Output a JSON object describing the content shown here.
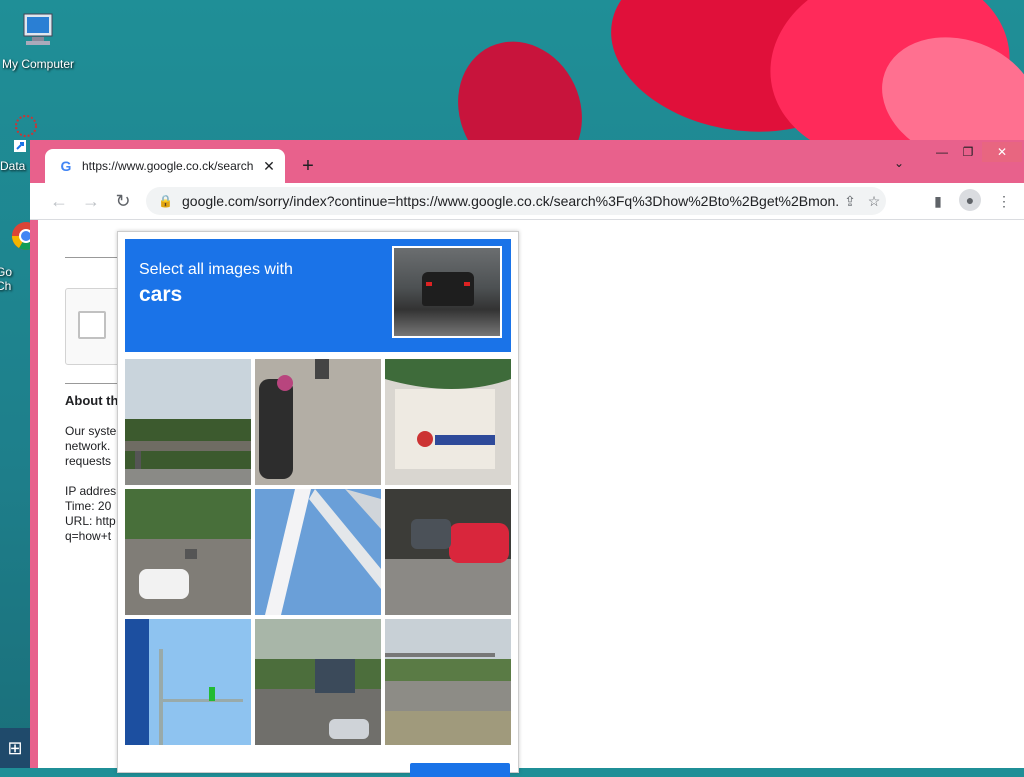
{
  "desktop": {
    "icons": [
      {
        "label": "My Computer"
      },
      {
        "label": "Data"
      },
      {
        "label": "Go Ch"
      }
    ]
  },
  "browser": {
    "tab": {
      "favicon": "G",
      "title": "https://www.google.co.ck/search"
    },
    "url": "google.com/sorry/index?continue=https://www.google.co.ck/search%3Fq%3Dhow%2Bto%2Bget%2Bmon..."
  },
  "page": {
    "about_heading": "About th",
    "paragraph": [
      "Our syste",
      "network.",
      "requests"
    ],
    "details": [
      "IP addres",
      "Time: 20",
      "URL: http",
      "q=how+t"
    ]
  },
  "captcha": {
    "instruction": "Select all images with",
    "target": "cars",
    "tiles": [
      {
        "label": "overpass-bridge"
      },
      {
        "label": "motorcycle"
      },
      {
        "label": "building-street"
      },
      {
        "label": "road-traffic-white-car"
      },
      {
        "label": "steel-truss-bridge"
      },
      {
        "label": "parked-red-car"
      },
      {
        "label": "traffic-light-pole"
      },
      {
        "label": "highway-cars-bus"
      },
      {
        "label": "roadside-bridge"
      }
    ]
  }
}
